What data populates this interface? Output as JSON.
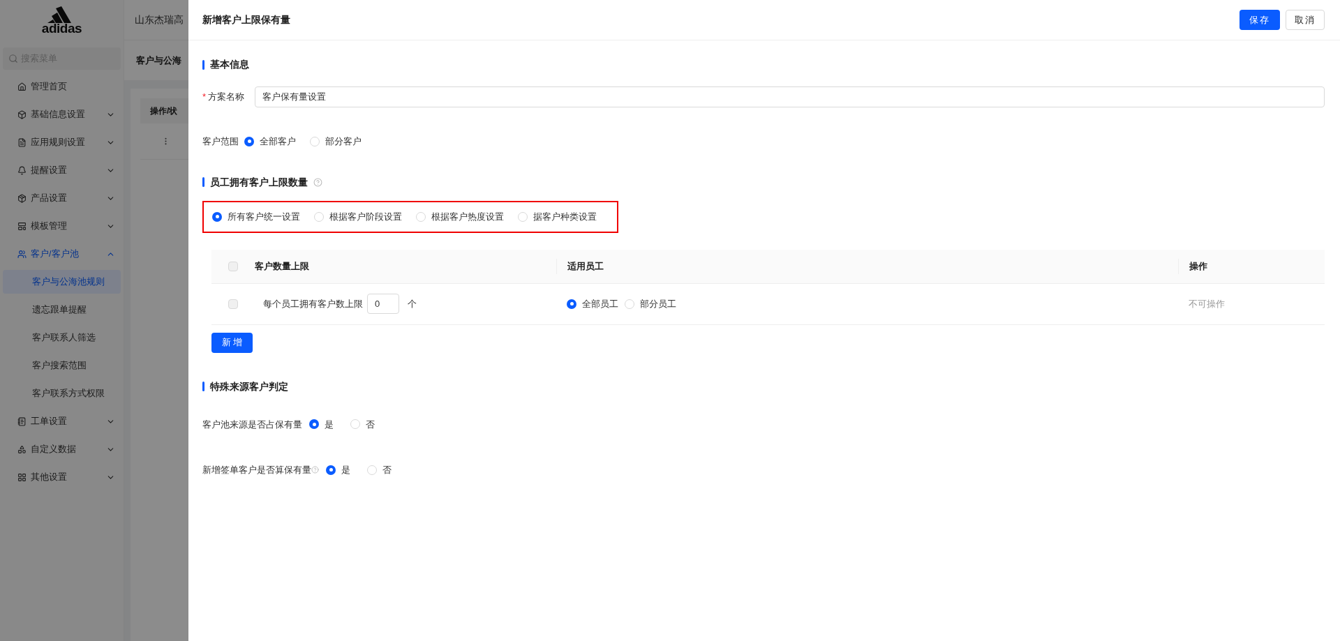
{
  "background": {
    "logo": "adidas",
    "header_title": "山东杰瑞高",
    "search_placeholder": "搜索菜单",
    "breadcrumb": "客户与公海",
    "table_header": "操作/状",
    "menu": [
      {
        "kind": "link",
        "label": "管理首页",
        "selected": false
      },
      {
        "kind": "group",
        "label": "基础信息设置",
        "selected": false,
        "expanded": false
      },
      {
        "kind": "group",
        "label": "应用规则设置",
        "selected": false,
        "expanded": false
      },
      {
        "kind": "group",
        "label": "提醒设置",
        "selected": false,
        "expanded": false
      },
      {
        "kind": "group",
        "label": "产品设置",
        "selected": false,
        "expanded": false
      },
      {
        "kind": "group",
        "label": "模板管理",
        "selected": false,
        "expanded": false
      },
      {
        "kind": "group",
        "label": "客户/客户池",
        "selected": true,
        "expanded": true,
        "children": [
          {
            "label": "客户与公海池规则",
            "selected": true
          },
          {
            "label": "遗忘跟单提醒",
            "selected": false
          },
          {
            "label": "客户联系人筛选",
            "selected": false
          },
          {
            "label": "客户搜索范围",
            "selected": false
          },
          {
            "label": "客户联系方式权限",
            "selected": false
          }
        ]
      },
      {
        "kind": "group",
        "label": "工单设置",
        "selected": false,
        "expanded": false
      },
      {
        "kind": "group",
        "label": "自定义数据",
        "selected": false,
        "expanded": false
      },
      {
        "kind": "group",
        "label": "其他设置",
        "selected": false,
        "expanded": false
      }
    ]
  },
  "drawer": {
    "title": "新增客户上限保有量",
    "buttons": [
      {
        "label": "保存",
        "kind": "primary"
      },
      {
        "label": "取消",
        "kind": "default"
      }
    ],
    "basic": {
      "title": "基本信息",
      "name_field": {
        "required_mark": "*",
        "label": "方案名称",
        "value": "客户保有量设置"
      },
      "scope": {
        "label": "客户范围",
        "options": [
          {
            "label": "全部客户",
            "selected": true
          },
          {
            "label": "部分客户",
            "selected": false
          }
        ]
      }
    },
    "quota": {
      "title": "员工拥有客户上限数量",
      "help": true,
      "highlighted": true,
      "modes": [
        {
          "label": "所有客户统一设置",
          "selected": true
        },
        {
          "label": "根据客户阶段设置",
          "selected": false
        },
        {
          "label": "根据客户热度设置",
          "selected": false
        },
        {
          "label": "据客户种类设置",
          "selected": false
        }
      ],
      "table": {
        "header_checked": false,
        "columns": [
          "客户数量上限",
          "适用员工",
          "操作"
        ],
        "rows": [
          {
            "checked": false,
            "label": "每个员工拥有客户数上限",
            "value": "0",
            "unit": "个",
            "staff": [
              {
                "label": "全部员工",
                "selected": true
              },
              {
                "label": "部分员工",
                "selected": false
              }
            ],
            "action": "不可操作"
          }
        ]
      },
      "add_button": "新 增"
    },
    "special": {
      "title": "特殊来源客户判定",
      "fields": [
        {
          "label": "客户池来源是否占保有量",
          "help": false,
          "options": [
            {
              "label": "是",
              "selected": true
            },
            {
              "label": "否",
              "selected": false
            }
          ]
        },
        {
          "label": "新增签单客户是否算保有量",
          "help": true,
          "options": [
            {
              "label": "是",
              "selected": true
            },
            {
              "label": "否",
              "selected": false
            }
          ]
        }
      ]
    }
  }
}
